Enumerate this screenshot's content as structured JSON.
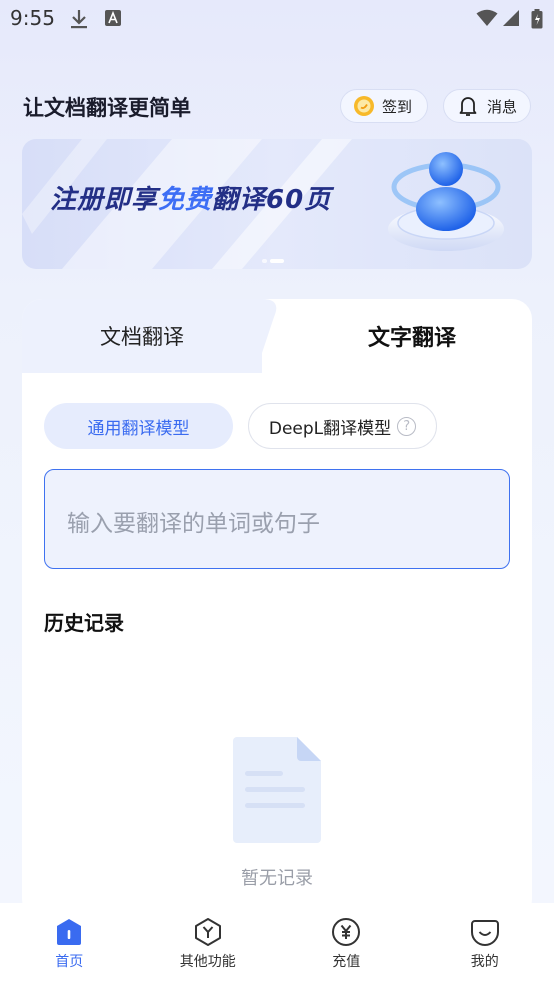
{
  "status_bar": {
    "time": "9:55"
  },
  "header": {
    "title": "让文档翻译更简单",
    "checkin_label": "签到",
    "message_label": "消息"
  },
  "banner": {
    "text_prefix": "注册即享",
    "text_highlight": "免费",
    "text_suffix": "翻译60页",
    "page_count": 2,
    "active_page": 2
  },
  "tabs": [
    {
      "label": "文档翻译",
      "active": false
    },
    {
      "label": "文字翻译",
      "active": true
    }
  ],
  "models": [
    {
      "label": "通用翻译模型",
      "selected": true
    },
    {
      "label": "DeepL翻译模型",
      "selected": false
    }
  ],
  "input": {
    "placeholder": "输入要翻译的单词或句子",
    "value": ""
  },
  "history": {
    "title": "历史记录",
    "empty_text": "暂无记录"
  },
  "bottom_nav": [
    {
      "label": "首页",
      "icon": "home-icon",
      "active": true
    },
    {
      "label": "其他功能",
      "icon": "hexagon-y-icon",
      "active": false
    },
    {
      "label": "充值",
      "icon": "yuan-circle-icon",
      "active": false
    },
    {
      "label": "我的",
      "icon": "smile-face-icon",
      "active": false
    }
  ],
  "colors": {
    "accent": "#3a6bf0",
    "banner_text": "#232f86",
    "highlight": "#3d6ef5"
  }
}
